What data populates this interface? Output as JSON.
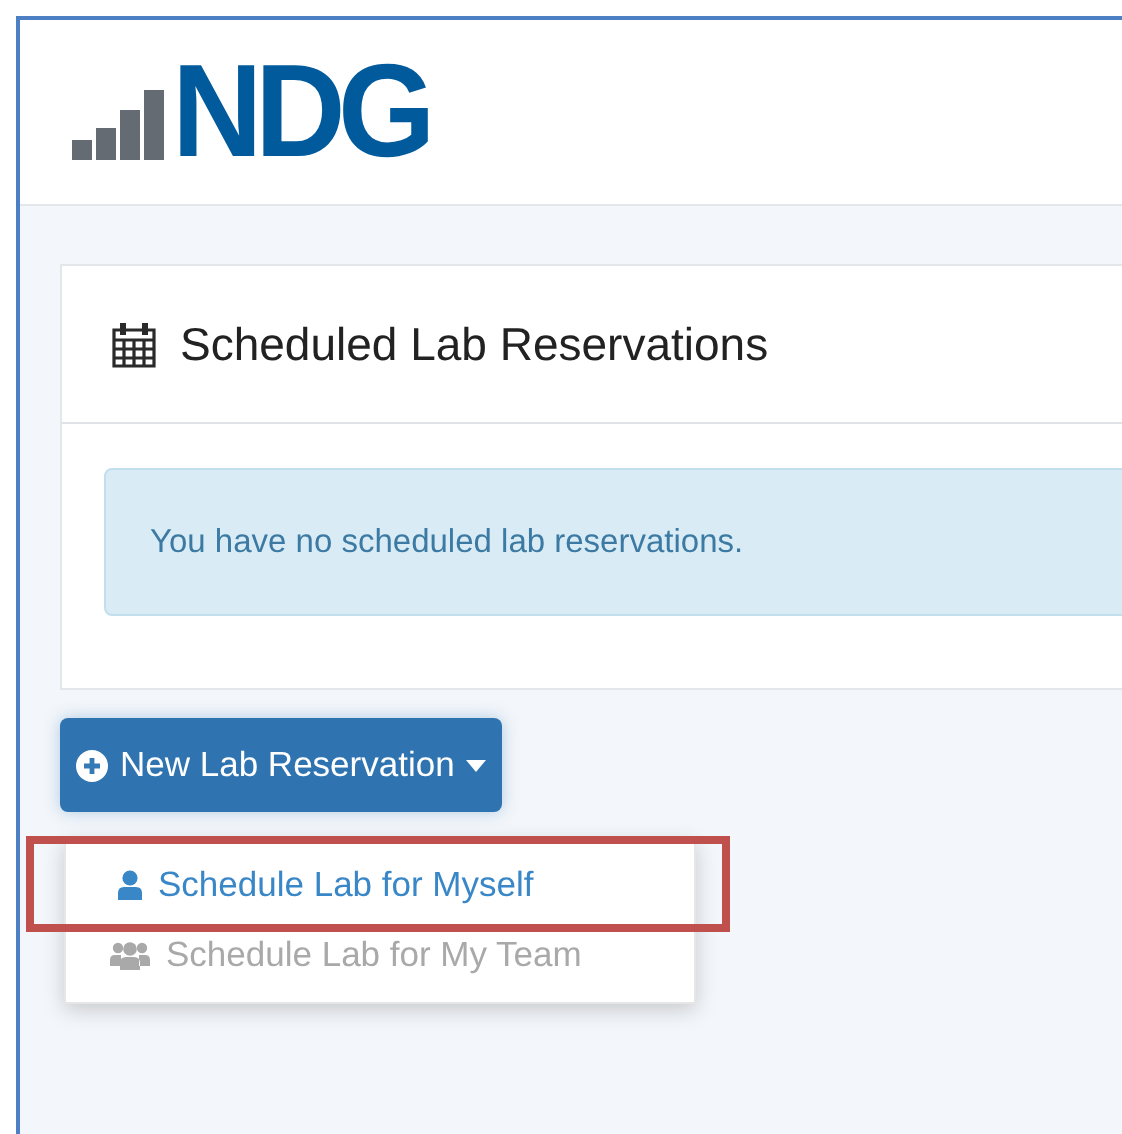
{
  "logo": {
    "text": "NDG"
  },
  "panel": {
    "title": "Scheduled Lab Reservations",
    "alert": "You have no scheduled lab reservations."
  },
  "new_button": {
    "label": "New Lab Reservation",
    "expanded": true
  },
  "menu": [
    {
      "kind": "person",
      "label": "Schedule Lab for Myself",
      "disabled": false,
      "highlighted": true
    },
    {
      "kind": "team",
      "label": "Schedule Lab for My Team",
      "disabled": true,
      "highlighted": false
    }
  ]
}
